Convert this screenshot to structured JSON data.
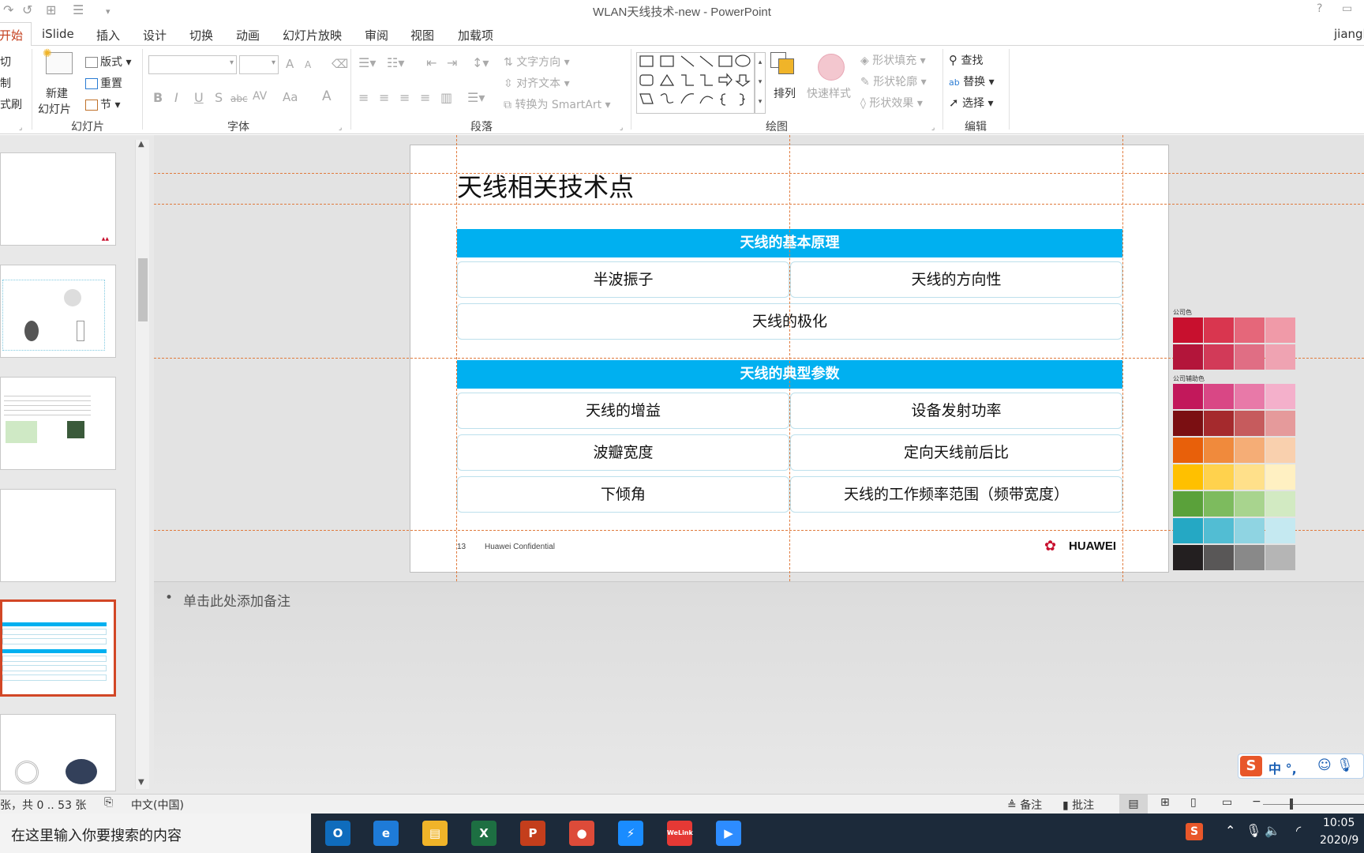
{
  "window": {
    "title": "WLAN天线技术-new - PowerPoint",
    "user": "jiangl"
  },
  "tabs": [
    "开始",
    "iSlide",
    "插入",
    "设计",
    "切换",
    "动画",
    "幻灯片放映",
    "审阅",
    "视图",
    "加载项"
  ],
  "ribbon": {
    "clipboard": {
      "cut": "切",
      "copy": "制",
      "painter": "式刷"
    },
    "slides": {
      "new_slide": "新建",
      "new_slide2": "幻灯片",
      "layout": "版式",
      "reset": "重置",
      "section": "节",
      "group": "幻灯片"
    },
    "font": {
      "group": "字体",
      "bold": "B",
      "italic": "I",
      "underline": "U",
      "shadow": "S",
      "strike": "abc",
      "spacing": "AV",
      "case": "Aa",
      "color": "A",
      "grow": "A",
      "shrink": "A"
    },
    "paragraph": {
      "group": "段落",
      "text_direction": "文字方向",
      "align_text": "对齐文本",
      "smartart": "转换为 SmartArt"
    },
    "drawing": {
      "group": "绘图",
      "arrange": "排列",
      "quick_styles": "快速样式",
      "fill": "形状填充",
      "outline": "形状轮廓",
      "effects": "形状效果"
    },
    "editing": {
      "group": "编辑",
      "find": "查找",
      "replace": "替换",
      "select": "选择"
    }
  },
  "slide": {
    "title": "天线相关技术点",
    "section1": "天线的基本原理",
    "row1": [
      "半波振子",
      "天线的方向性"
    ],
    "row2": "天线的极化",
    "section2": "天线的典型参数",
    "row3": [
      "天线的增益",
      "设备发射功率"
    ],
    "row4": [
      "波瓣宽度",
      "定向天线前后比"
    ],
    "row5": [
      "下倾角",
      "天线的工作频率范围（频带宽度）"
    ],
    "page_number": "13",
    "confidential": "Huawei Confidential",
    "logo": "HUAWEI"
  },
  "palette": {
    "company_label": "公司色",
    "aux_label": "公司辅助色",
    "rows": [
      [
        "#c8102e",
        "#d9364f",
        "#e5677a",
        "#f09aa8"
      ],
      [
        "#b3153a",
        "#d23a58",
        "#e06e84",
        "#efa3b2"
      ],
      [
        "#c2185b",
        "#d94785",
        "#e879a8",
        "#f4b0cb"
      ],
      [
        "#7b0f12",
        "#a52a2d",
        "#c65b5d",
        "#e59a9b"
      ],
      [
        "#e8600a",
        "#f08a3c",
        "#f5ad76",
        "#f9d0ae"
      ],
      [
        "#ffc000",
        "#ffd24d",
        "#ffe08a",
        "#fff0c2"
      ],
      [
        "#5aa13a",
        "#7dbb5e",
        "#a8d48e",
        "#d2eac2"
      ],
      [
        "#25a8c4",
        "#52bdd3",
        "#8fd4e2",
        "#c5e9f1"
      ],
      [
        "#231f20",
        "#595757",
        "#898989",
        "#b5b5b5"
      ]
    ]
  },
  "notes": {
    "placeholder": "单击此处添加备注"
  },
  "status": {
    "slide_info": "张，共 0 .. 53 张",
    "language": "中文(中国)",
    "notes": "备注",
    "comments": "批注"
  },
  "ime": {
    "text": "中 °,"
  },
  "taskbar": {
    "search_placeholder": "在这里输入你要搜索的内容",
    "apps": [
      {
        "name": "outlook",
        "color": "#0f6cbd",
        "glyph": "O"
      },
      {
        "name": "ie",
        "color": "#1e7bd8",
        "glyph": "e"
      },
      {
        "name": "explorer",
        "color": "#f0b429",
        "glyph": "▤"
      },
      {
        "name": "excel",
        "color": "#1d6f42",
        "glyph": "X"
      },
      {
        "name": "powerpoint",
        "color": "#c43e1c",
        "glyph": "P"
      },
      {
        "name": "chrome",
        "color": "#dd4b39",
        "glyph": "●"
      },
      {
        "name": "thunder",
        "color": "#1a8cff",
        "glyph": "⚡"
      },
      {
        "name": "welink",
        "color": "#e53935",
        "glyph": "WeLink"
      },
      {
        "name": "zoom",
        "color": "#2d8cff",
        "glyph": "▶"
      }
    ],
    "clock_time": "10:05",
    "clock_date": "2020/9"
  }
}
